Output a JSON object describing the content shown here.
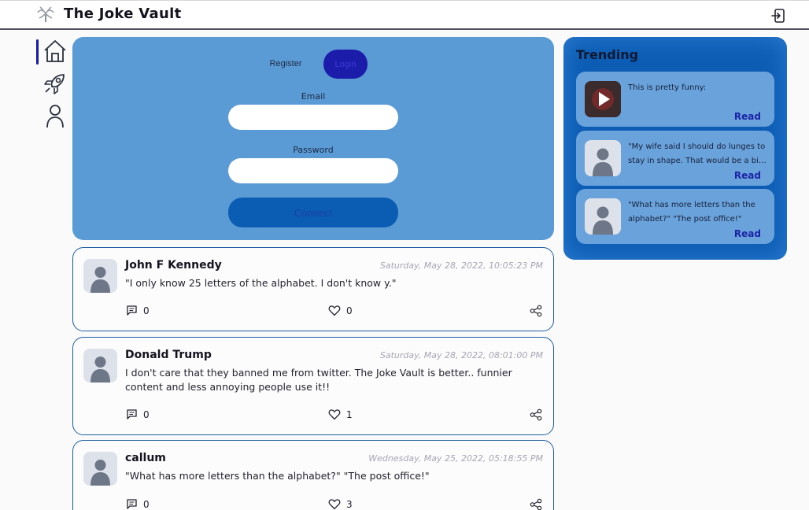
{
  "header": {
    "title": "The Joke Vault"
  },
  "icons": {
    "logo": "palm-tree-icon",
    "logout": "logout-icon",
    "home": "home-icon",
    "explore": "rocket-icon",
    "profile": "user-icon",
    "comment": "comment-icon",
    "like": "heart-icon",
    "share": "share-icon",
    "play": "play-icon"
  },
  "auth": {
    "register_label": "Register",
    "login_label": "Login",
    "email_label": "Email",
    "email_value": "",
    "password_label": "Password",
    "password_value": "",
    "connect_label": "Connect"
  },
  "posts": [
    {
      "author": "John F Kennedy",
      "time": "Saturday, May 28, 2022, 10:05:23 PM",
      "body": "\"I only know 25 letters of the alphabet. I don't know y.\"",
      "comments": "0",
      "likes": "0"
    },
    {
      "author": "Donald Trump",
      "time": "Saturday, May 28, 2022, 08:01:00 PM",
      "body": "I don't care that they banned me from twitter. The Joke Vault is better.. funnier content and less annoying people use it!!",
      "comments": "0",
      "likes": "1"
    },
    {
      "author": "callum",
      "time": "Wednesday, May 25, 2022, 05:18:55 PM",
      "body": "\"What has more letters than the alphabet?\" \"The post office!\"",
      "comments": "0",
      "likes": "3"
    }
  ],
  "trending": {
    "title": "Trending",
    "items": [
      {
        "text": "This is pretty funny:",
        "read_label": "Read"
      },
      {
        "text": "\"My wife said I should do lunges to stay in shape. That would be a big step forward.\"",
        "read_label": "Read"
      },
      {
        "text": "\"What has more letters than the alphabet?\" \"The post office!\"",
        "read_label": "Read"
      }
    ]
  },
  "colors": {
    "accent": "#1c1cab",
    "panel": "#5b9bd5",
    "trending_bg": "#0d5db5",
    "post_border": "#1f5ea0"
  }
}
